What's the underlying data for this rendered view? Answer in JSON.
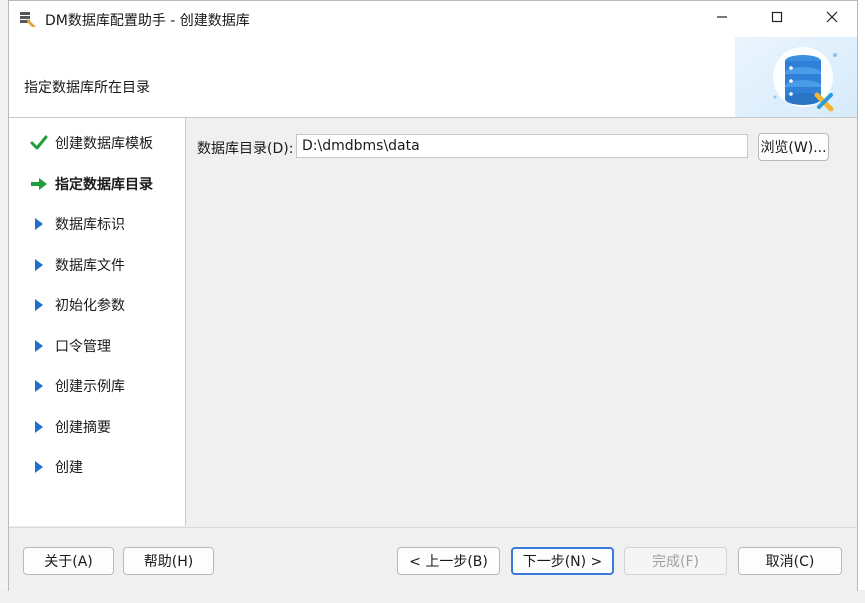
{
  "window": {
    "title": "DM数据库配置助手 - 创建数据库",
    "controls": [
      "minimize-icon",
      "maximize-icon",
      "close-icon"
    ]
  },
  "header": {
    "subtitle": "指定数据库所在目录",
    "art_icon": "database-gear-icon"
  },
  "steps": [
    {
      "label": "创建数据库模板",
      "status": "done",
      "icon": "check-icon"
    },
    {
      "label": "指定数据库目录",
      "status": "current",
      "icon": "arrow-right-icon"
    },
    {
      "label": "数据库标识",
      "status": "pending",
      "icon": "triangle-right-icon"
    },
    {
      "label": "数据库文件",
      "status": "pending",
      "icon": "triangle-right-icon"
    },
    {
      "label": "初始化参数",
      "status": "pending",
      "icon": "triangle-right-icon"
    },
    {
      "label": "口令管理",
      "status": "pending",
      "icon": "triangle-right-icon"
    },
    {
      "label": "创建示例库",
      "status": "pending",
      "icon": "triangle-right-icon"
    },
    {
      "label": "创建摘要",
      "status": "pending",
      "icon": "triangle-right-icon"
    },
    {
      "label": "创建",
      "status": "pending",
      "icon": "triangle-right-icon"
    }
  ],
  "form": {
    "dir_label": "数据库目录(D):",
    "dir_value": "D:\\dmdbms\\data",
    "browse_label": "浏览(W)..."
  },
  "footer": {
    "about": "关于(A)",
    "help": "帮助(H)",
    "prev": "< 上一步(B)",
    "next": "下一步(N) >",
    "finish": "完成(F)",
    "cancel": "取消(C)"
  },
  "colors": {
    "done": "#1e9e3c",
    "current": "#1e9e3c",
    "pending": "#1f6fd1",
    "default_button_border": "#3a7ad9"
  }
}
